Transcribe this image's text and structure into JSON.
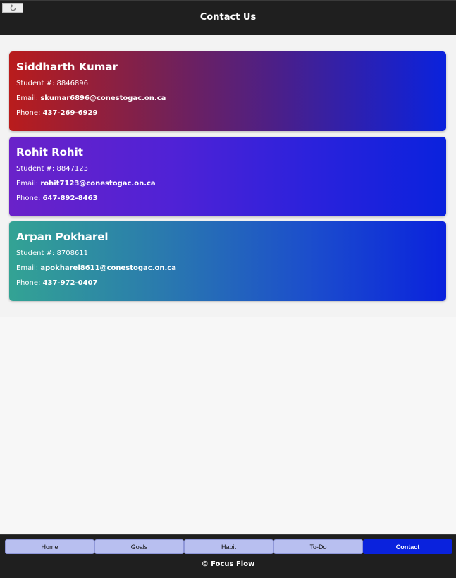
{
  "header": {
    "title": "Contact Us",
    "back_icon": "back-arrow-icon"
  },
  "contacts": [
    {
      "name": "Siddharth Kumar",
      "student_label": "Student #:",
      "student_number": "8846896",
      "email_label": "Email:",
      "email": "skumar6896@conestogac.on.ca",
      "phone_label": "Phone:",
      "phone": "437-269-6929"
    },
    {
      "name": "Rohit Rohit",
      "student_label": "Student #:",
      "student_number": "8847123",
      "email_label": "Email:",
      "email": "rohit7123@conestogac.on.ca",
      "phone_label": "Phone:",
      "phone": "647-892-8463"
    },
    {
      "name": "Arpan Pokharel",
      "student_label": "Student #:",
      "student_number": "8708611",
      "email_label": "Email:",
      "email": "apokharel8611@conestogac.on.ca",
      "phone_label": "Phone:",
      "phone": "437-972-0407"
    }
  ],
  "nav": {
    "items": [
      {
        "label": "Home"
      },
      {
        "label": "Goals"
      },
      {
        "label": "Habit"
      },
      {
        "label": "To-Do"
      },
      {
        "label": "Contact"
      }
    ],
    "active": "Contact"
  },
  "footer": {
    "text": "© Focus Flow"
  },
  "colors": {
    "header_bg": "#1f1f1f",
    "accent": "#0a22dd",
    "nav_inactive": "#b8bff0"
  }
}
